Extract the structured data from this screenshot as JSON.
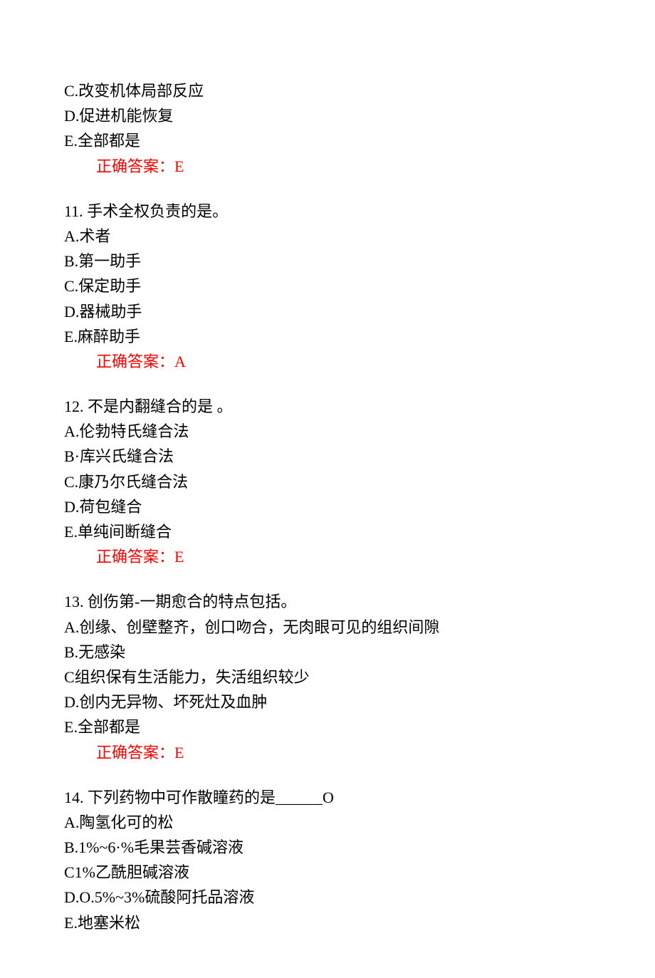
{
  "q10": {
    "optC": "C.改变机体局部反应",
    "optD": "D.促进机能恢复",
    "optE": "E.全部都是",
    "answer": "正确答案：E"
  },
  "q11": {
    "stem": "11.  手术全权负责的是。",
    "optA": "A.术者",
    "optB": "B.第一助手",
    "optC": "C.保定助手",
    "optD": "D.器械助手",
    "optE": "E.麻醉助手",
    "answer": "正确答案：A"
  },
  "q12": {
    "stem": "12.  不是内翻缝合的是     。",
    "optA": "A.伦勃特氏缝合法",
    "optB": "B·库兴氏缝合法",
    "optC": "C.康乃尔氏缝合法",
    "optD": "D.荷包缝合",
    "optE": "E.单纯间断缝合",
    "answer": "正确答案：E"
  },
  "q13": {
    "stem": "13.  创伤第-一期愈合的特点包括。",
    "optA": "A.创缘、创壁整齐，创口吻合，无肉眼可见的组织间隙",
    "optB": "B.无感染",
    "optC": "C组织保有生活能力，失活组织较少",
    "optD": "D.创内无异物、坏死灶及血肿",
    "optE": "E.全部都是",
    "answer": "正确答案：E"
  },
  "q14": {
    "stem": "14.  下列药物中可作散瞳药的是______O",
    "optA": "A.陶氢化可的松",
    "optB": "B.1%~6·%毛果芸香碱溶液",
    "optC": "C1%乙酰胆碱溶液",
    "optD": "D.O.5%~3%硫酸阿托品溶液",
    "optE": "E.地塞米松"
  }
}
